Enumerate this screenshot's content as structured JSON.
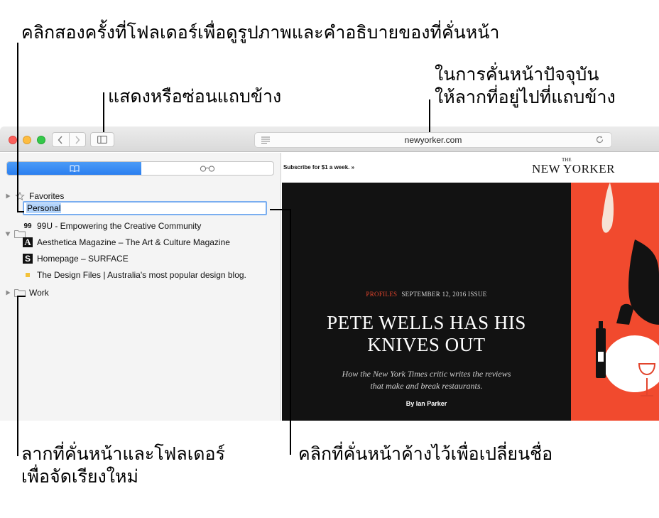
{
  "callouts": {
    "top": "คลิกสองครั้งที่โฟลเดอร์เพื่อดูรูปภาพและคำอธิบายของที่คั่นหน้า",
    "sidebar_toggle": "แสดงหรือซ่อนแถบข้าง",
    "drag_address": [
      "ในการคั่นหน้าปัจจุบัน",
      "ให้ลากที่อยู่ไปที่แถบข้าง"
    ],
    "rearrange": [
      "ลากที่คั่นหน้าและโฟลเดอร์",
      "เพื่อจัดเรียงใหม่"
    ],
    "rename": "คลิกที่คั่นหน้าค้างไว้เพื่อเปลี่ยนชื่อ"
  },
  "toolbar": {
    "address": "newyorker.com"
  },
  "sidebar": {
    "tabs": [
      {
        "icon": "book-icon",
        "selected": true
      },
      {
        "icon": "reading-glasses-icon",
        "selected": false
      }
    ],
    "favorites_label": "Favorites",
    "personal_label": "Personal",
    "bookmarks": [
      {
        "icon_text": "99",
        "label": "99U - Empowering the Creative Community"
      },
      {
        "icon_text": "A",
        "label": "Aesthetica Magazine – The Art & Culture Magazine"
      },
      {
        "icon_text": "S",
        "label": "Homepage – SURFACE"
      },
      {
        "icon_text": "",
        "label": "The Design Files | Australia's most popular design blog."
      }
    ],
    "work_label": "Work"
  },
  "page": {
    "subscribe": "Subscribe for $1 a week. »",
    "logo_the": "THE",
    "logo": "NEW YORKER",
    "kicker_section": "PROFILES",
    "kicker_issue": "SEPTEMBER 12, 2016 ISSUE",
    "headline": [
      "PETE WELLS HAS HIS",
      "KNIVES OUT"
    ],
    "dek": [
      "How the New York Times critic writes the reviews",
      "that make and break restaurants."
    ],
    "byline": "By Ian Parker"
  },
  "colors": {
    "accent_blue": "#2b7ff0",
    "hero_red": "#f14a2e",
    "hero_black": "#121212"
  }
}
